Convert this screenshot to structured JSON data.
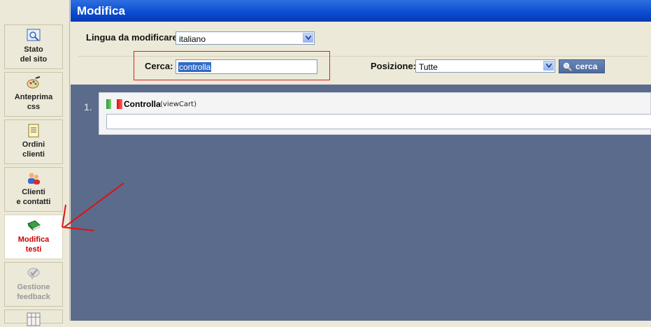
{
  "header": {
    "title": "Modifica"
  },
  "sidebar": {
    "items": [
      {
        "label1": "Stato",
        "label2": "del sito",
        "icon": "site-status-icon",
        "state": "normal"
      },
      {
        "label1": "Anteprima",
        "label2": "css",
        "icon": "palette-icon",
        "state": "normal"
      },
      {
        "label1": "Ordini",
        "label2": "clienti",
        "icon": "orders-icon",
        "state": "normal"
      },
      {
        "label1": "Clienti",
        "label2": "e contatti",
        "icon": "users-icon",
        "state": "normal"
      },
      {
        "label1": "Modifica",
        "label2": "testi",
        "icon": "book-icon",
        "state": "active"
      },
      {
        "label1": "Gestione",
        "label2": "feedback",
        "icon": "feedback-icon",
        "state": "disabled"
      }
    ]
  },
  "form": {
    "language_label": "Lingua da modificare:",
    "language_value": "italiano",
    "search_label": "Cerca:",
    "search_value": "controlla",
    "position_label": "Posizione:",
    "position_value": "Tutte",
    "search_button": "cerca"
  },
  "results": [
    {
      "number": "1.",
      "name": "Controlla",
      "key": "(viewCart)",
      "value": ""
    }
  ],
  "colors": {
    "header": "#0a4bd0",
    "content_bg": "#5b6b8b",
    "active_text": "#cc0000",
    "highlight_box": "#e02020"
  }
}
